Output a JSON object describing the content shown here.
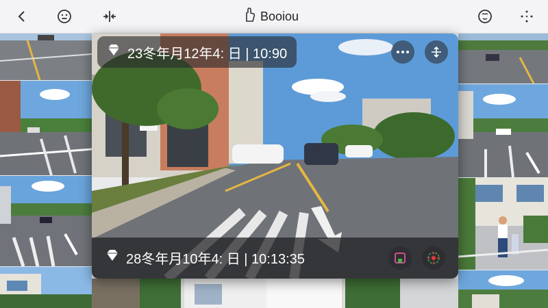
{
  "app": {
    "title": "Booiou"
  },
  "toolbar": {
    "back_icon": "chevron-left-icon",
    "face_icon": "smiley-icon",
    "compare_icon": "split-arrows-icon",
    "title_icon": "hand-pointer-icon",
    "settings_icon": "face-circle-icon",
    "move_icon": "drag-cross-icon"
  },
  "card": {
    "top_timestamp": "23冬年月12年4: 日 | 10:90",
    "bottom_timestamp": "28冬年月10年4: 日 | 10:13:35",
    "more_icon": "ellipsis-icon",
    "move_icon": "move-arrows-icon",
    "save_icon": "save-icon",
    "target_icon": "crosshair-icon",
    "badge_icon": "diamond-icon"
  },
  "colors": {
    "toolbar_bg": "#f4f4f6",
    "road": "#6f7378",
    "sky": "#5d9bd8",
    "lane_yellow": "#e6b640",
    "save_accent": "#e0559a",
    "target_accent": "#e23b3b"
  }
}
